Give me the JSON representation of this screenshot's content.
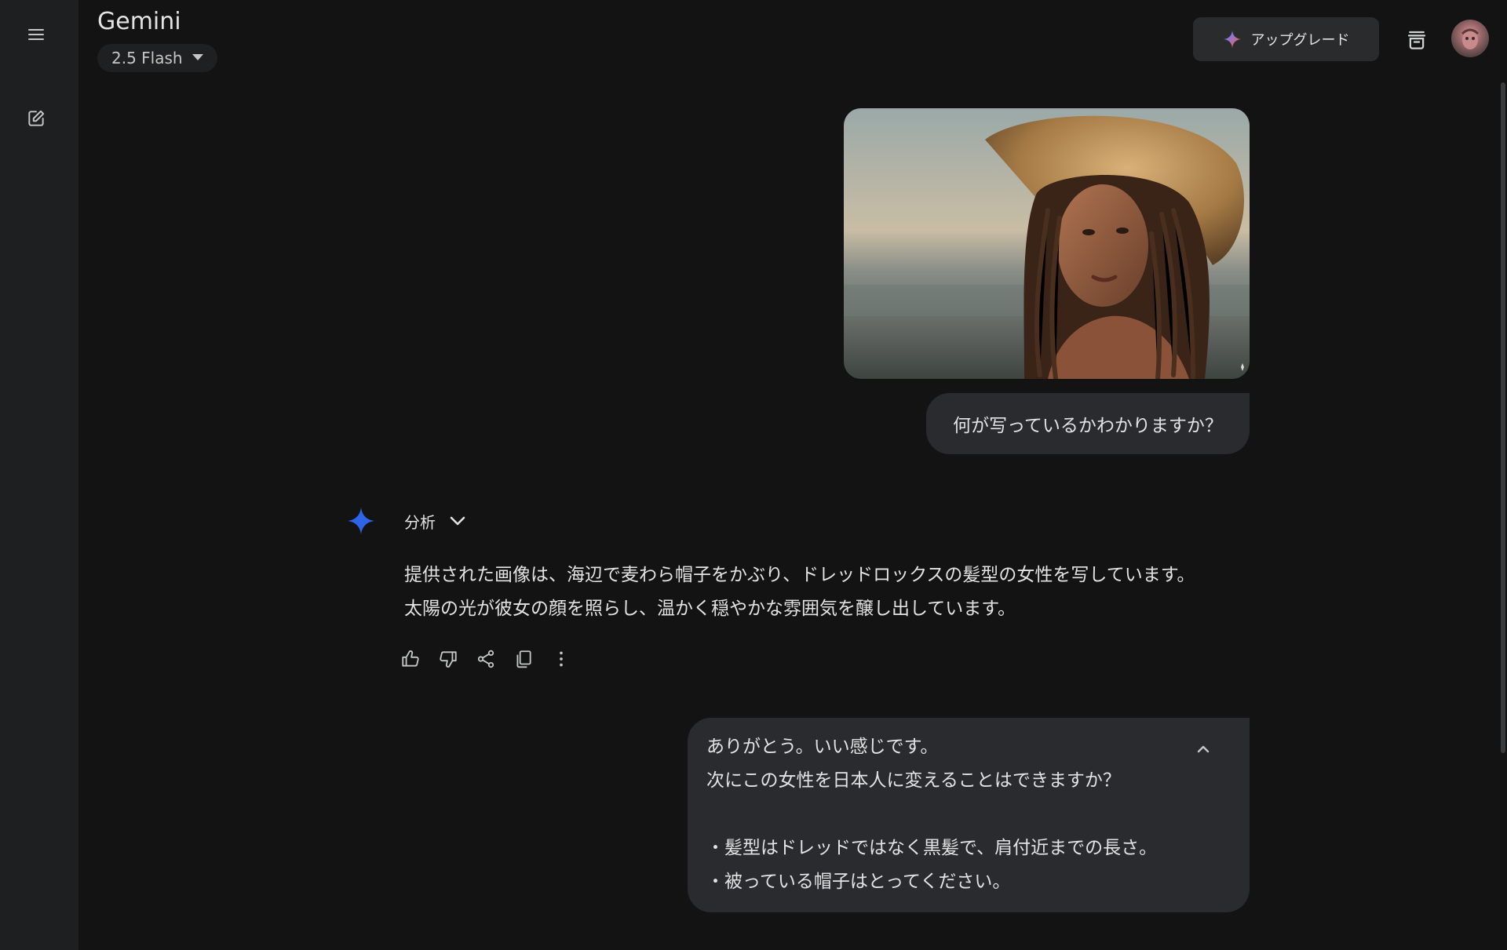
{
  "app": {
    "title": "Gemini",
    "model_selector": {
      "label": "2.5 Flash"
    },
    "upgrade_button": {
      "label": "アップグレード"
    }
  },
  "sidebar": {
    "icons": [
      "menu-icon",
      "new-chat-icon"
    ]
  },
  "header": {
    "icons": [
      "temporary-chat-icon",
      "avatar"
    ]
  },
  "conversation": {
    "user_message_1": {
      "image_alt": "Woman with dreadlocks wearing a straw hat at the beach",
      "text": "何が写っているかわかりますか？"
    },
    "model_response_1": {
      "header_label": "分析",
      "lines": [
        "提供された画像は、海辺で麦わら帽子をかぶり、ドレッドロックスの髪型の女性を写しています。",
        "太陽の光が彼女の顔を照らし、温かく穏やかな雰囲気を醸し出しています。"
      ],
      "actions": [
        "thumbs-up-icon",
        "thumbs-down-icon",
        "share-icon",
        "copy-icon",
        "more-vert-icon"
      ]
    },
    "user_message_2": {
      "lines": [
        "ありがとう。いい感じです。",
        "次にこの女性を日本人に変えることはできますか？",
        "",
        "・髪型はドレッドではなく黒髪で、肩付近までの長さ。",
        "・被っている帽子はとってください。"
      ]
    }
  },
  "colors": {
    "background": "#131314",
    "rail": "#1e1f20",
    "bubble": "#2a2b2e",
    "text": "#e3e3e3",
    "gemini_blue": "#2f64e8"
  }
}
